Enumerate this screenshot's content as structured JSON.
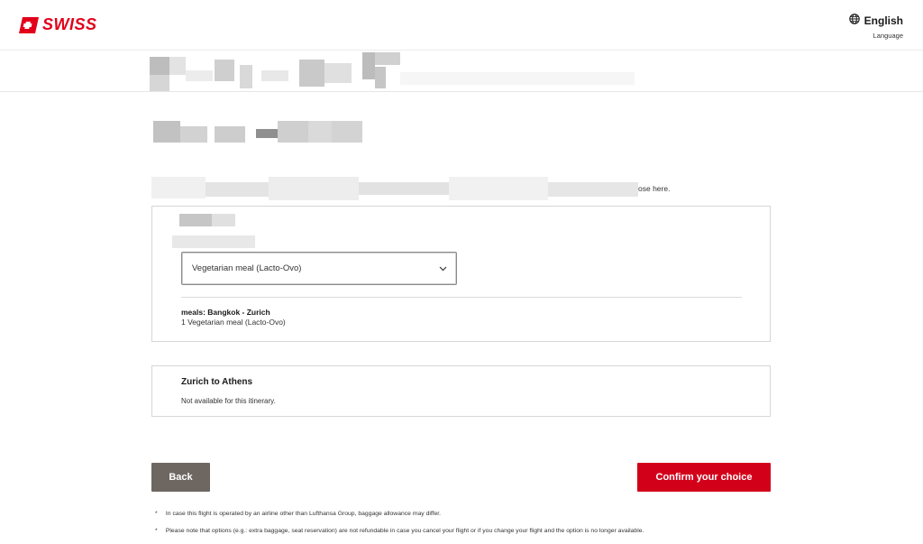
{
  "header": {
    "brand": "SWISS",
    "language": {
      "name": "English",
      "label": "Language"
    },
    "colors": {
      "brand_red": "#e2001a"
    },
    "icons": {
      "logo": "swiss-flag-icon",
      "language": "globe-icon"
    }
  },
  "intro": {
    "visible_tail": "ose here."
  },
  "meal_card": {
    "select": {
      "value": "Vegetarian meal (Lacto-Ovo)",
      "icon": "chevron-down-icon"
    },
    "summary": {
      "title": "meals: Bangkok - Zurich",
      "item": "1 Vegetarian meal (Lacto-Ovo)"
    }
  },
  "second_card": {
    "title": "Zurich to Athens",
    "text": "Not available for this itinerary."
  },
  "actions": {
    "back_label": "Back",
    "confirm_label": "Confirm your choice",
    "colors": {
      "back": "#6e6660",
      "confirm": "#d3001a"
    }
  },
  "footnotes": {
    "marker": "*",
    "note1": "In case this flight is operated by an airline other than Lufthansa Group, baggage allowance may differ.",
    "note2": "Please note that options (e.g.: extra baggage, seat reservation) are not refundable in case you cancel your flight or if you change your flight and the option is no longer available."
  }
}
